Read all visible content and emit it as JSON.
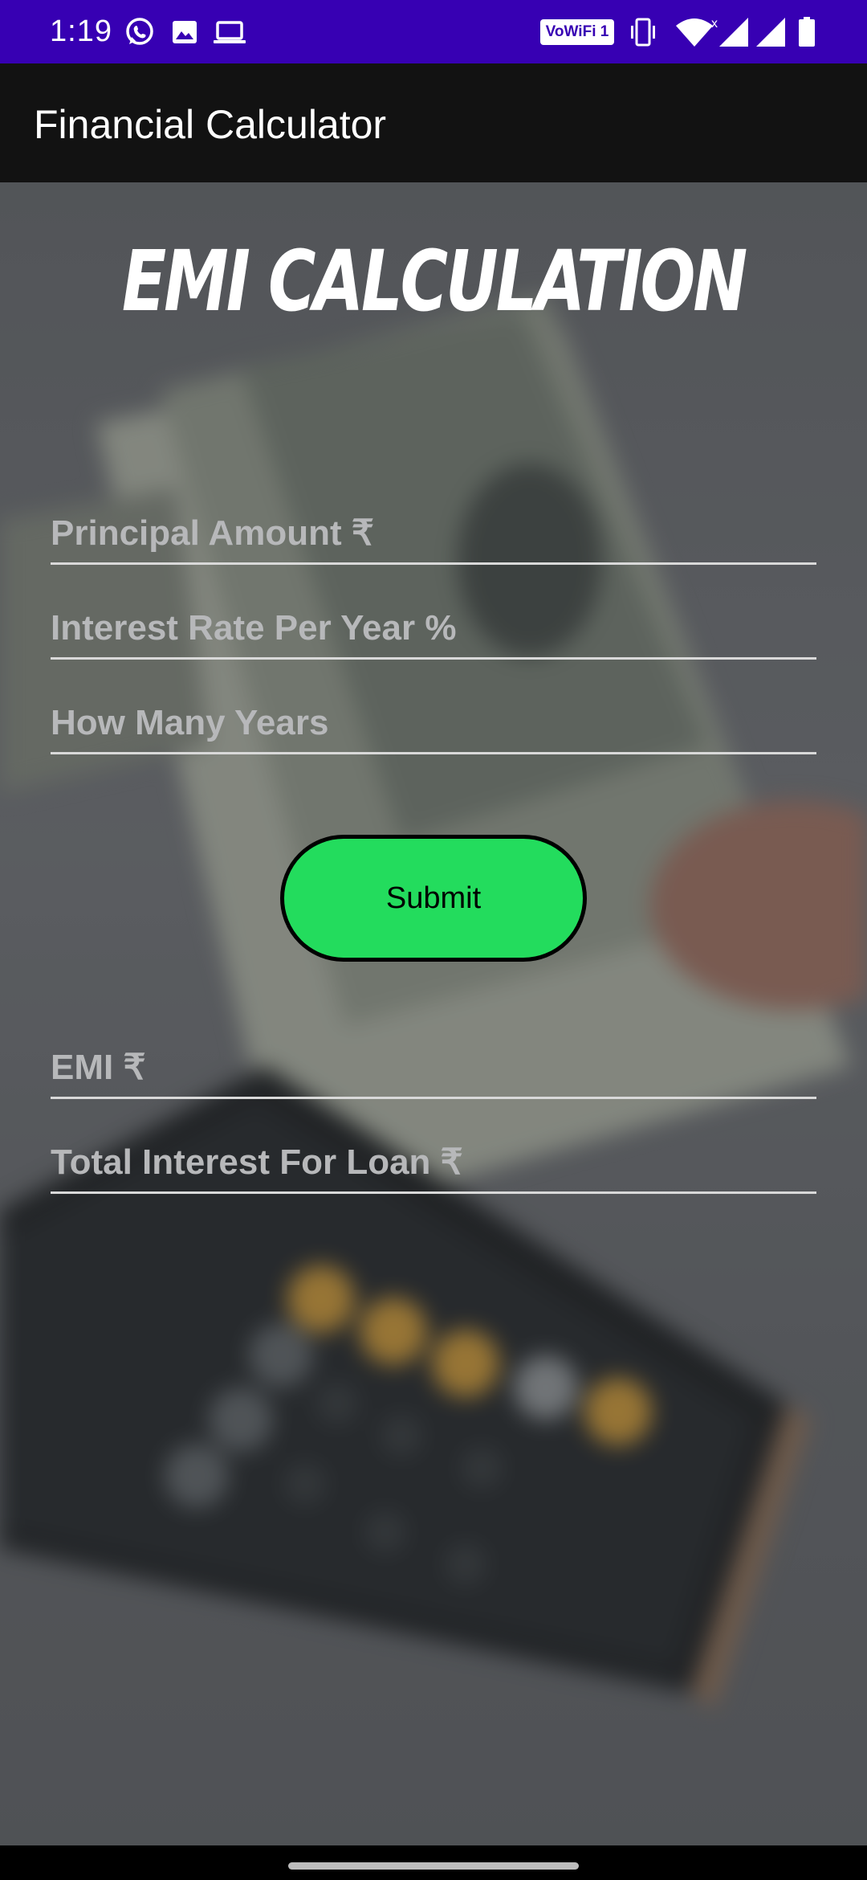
{
  "status_bar": {
    "time": "1:19",
    "wifi_badge": "VoWiFi 1",
    "icons": [
      "whatsapp-icon",
      "gallery-icon",
      "laptop-icon",
      "vibrate-icon",
      "wifi-icon",
      "signal-icon",
      "signal-icon",
      "battery-icon"
    ],
    "background_color": "#3700b3"
  },
  "app_bar": {
    "title": "Financial Calculator",
    "background_color": "#121212"
  },
  "main": {
    "heading": "EMI CALCULATION",
    "inputs": {
      "principal_placeholder": "Principal Amount ₹",
      "principal_value": "",
      "interest_placeholder": "Interest Rate Per Year %",
      "interest_value": "",
      "years_placeholder": "How Many Years",
      "years_value": ""
    },
    "submit_label": "Submit",
    "submit_color": "#23dc5d",
    "outputs": {
      "emi_placeholder": "EMI ₹",
      "emi_value": "",
      "total_interest_placeholder": "Total Interest For Loan ₹",
      "total_interest_value": ""
    }
  },
  "navigation": {
    "home_indicator": "gesture-bar"
  }
}
